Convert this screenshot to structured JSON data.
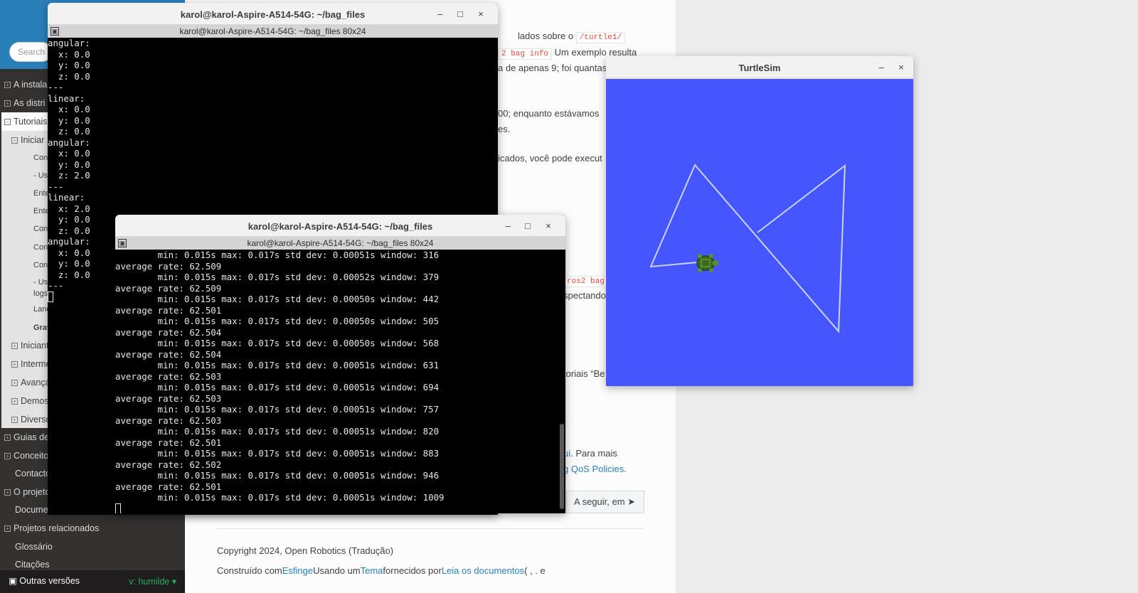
{
  "docs": {
    "search_placeholder": "Search d",
    "nav_top": [
      {
        "label": "A instala",
        "toggle": "+"
      },
      {
        "label": "As distri",
        "toggle": "+"
      }
    ],
    "nav_current": {
      "label": "Tutoriais",
      "toggle": "−"
    },
    "nav_sub": {
      "label": "Iniciar",
      "toggle": "−"
    },
    "nav_leaves": [
      "Con",
      "- Us",
      "Ente",
      "Ente",
      "Con",
      "Con",
      "Con",
      "- Us",
      "logs"
    ],
    "nav_leaf_launch": "Lançamento de nós",
    "nav_leaf_current": "Gravação e reprodução",
    "nav_tutorial_groups": [
      {
        "label": "Iniciante: Bibliotecas de",
        "toggle": "+"
      },
      {
        "label": "Intermediário",
        "toggle": "+"
      },
      {
        "label": "Avançado",
        "toggle": "+"
      },
      {
        "label": "Demos em",
        "toggle": "+"
      },
      {
        "label": "Diversos",
        "toggle": "+"
      }
    ],
    "nav_bottom": [
      {
        "label": "Guias de Como fazer",
        "toggle": "+"
      },
      {
        "label": "Conceitos",
        "toggle": "+"
      },
      {
        "label": "Contacto",
        "toggle": ""
      },
      {
        "label": "O projeto ROS 2",
        "toggle": "+"
      },
      {
        "label": "Documentação da API",
        "toggle": ""
      },
      {
        "label": "Projetos relacionados",
        "toggle": "+"
      },
      {
        "label": "Glossário",
        "toggle": ""
      },
      {
        "label": "Citações",
        "toggle": ""
      }
    ],
    "versions_label": "Outras versões",
    "versions_value": "v: humilde",
    "content": {
      "line1": "lados sobre o",
      "line1_code": "/turtle1/",
      "line2_code": "2 bag info",
      "line2": "Um exemplo resulta",
      "line3": "a de apenas 9; foi quantas",
      "line4": "00; enquanto estávamos",
      "line5": "es.",
      "line6": "icados, você pode execut",
      "line7_code": "ros2 bag",
      "line8": "spectando",
      "line9": "toriais “Be",
      "line10_link": "ui",
      "line10": ". Para mais",
      "line11_link": "g QoS Policies",
      "line11": ".",
      "next_button": "A seguir, em",
      "copyright": "Copyright 2024, Open Robotics (Tradução)",
      "built_with": "Construído com",
      "sphinx": "Esfinge",
      "using_a": "Usando um",
      "theme": "Tema",
      "provided_by": "fornecidos por",
      "rtd": "Leia os documentos",
      "tail": "( , . e"
    }
  },
  "terminal1": {
    "title": "karol@karol-Aspire-A514-54G: ~/bag_files",
    "tab_title": "karol@karol-Aspire-A514-54G: ~/bag_files 80x24",
    "lines": [
      "angular:",
      "  x: 0.0",
      "  y: 0.0",
      "  z: 0.0",
      "---",
      "linear:",
      "  x: 0.0",
      "  y: 0.0",
      "  z: 0.0",
      "angular:",
      "  x: 0.0",
      "  y: 0.0",
      "  z: 2.0",
      "---",
      "linear:",
      "  x: 2.0",
      "  y: 0.0",
      "  z: 0.0",
      "angular:",
      "  x: 0.0",
      "  y: 0.0",
      "  z: 0.0",
      "---"
    ]
  },
  "terminal2": {
    "title": "karol@karol-Aspire-A514-54G: ~/bag_files",
    "tab_title": "karol@karol-Aspire-A514-54G: ~/bag_files 80x24",
    "lines": [
      "        min: 0.015s max: 0.017s std dev: 0.00051s window: 316",
      "average rate: 62.509",
      "        min: 0.015s max: 0.017s std dev: 0.00052s window: 379",
      "average rate: 62.509",
      "        min: 0.015s max: 0.017s std dev: 0.00050s window: 442",
      "average rate: 62.501",
      "        min: 0.015s max: 0.017s std dev: 0.00050s window: 505",
      "average rate: 62.504",
      "        min: 0.015s max: 0.017s std dev: 0.00050s window: 568",
      "average rate: 62.504",
      "        min: 0.015s max: 0.017s std dev: 0.00051s window: 631",
      "average rate: 62.503",
      "        min: 0.015s max: 0.017s std dev: 0.00051s window: 694",
      "average rate: 62.503",
      "        min: 0.015s max: 0.017s std dev: 0.00051s window: 757",
      "average rate: 62.503",
      "        min: 0.015s max: 0.017s std dev: 0.00051s window: 820",
      "average rate: 62.501",
      "        min: 0.015s max: 0.017s std dev: 0.00051s window: 883",
      "average rate: 62.502",
      "        min: 0.015s max: 0.017s std dev: 0.00051s window: 946",
      "average rate: 62.501",
      "        min: 0.015s max: 0.017s std dev: 0.00051s window: 1009"
    ]
  },
  "turtlesim": {
    "title": "TurtleSim",
    "background_color": "#4556ff",
    "path_color": "#c8d2ff"
  },
  "window_buttons": {
    "minimize": "–",
    "maximize": "□",
    "close": "×"
  },
  "icons": {
    "book": "book-icon",
    "tab": "terminal-tab-icon",
    "arrow": "arrow-circle-right-icon"
  }
}
